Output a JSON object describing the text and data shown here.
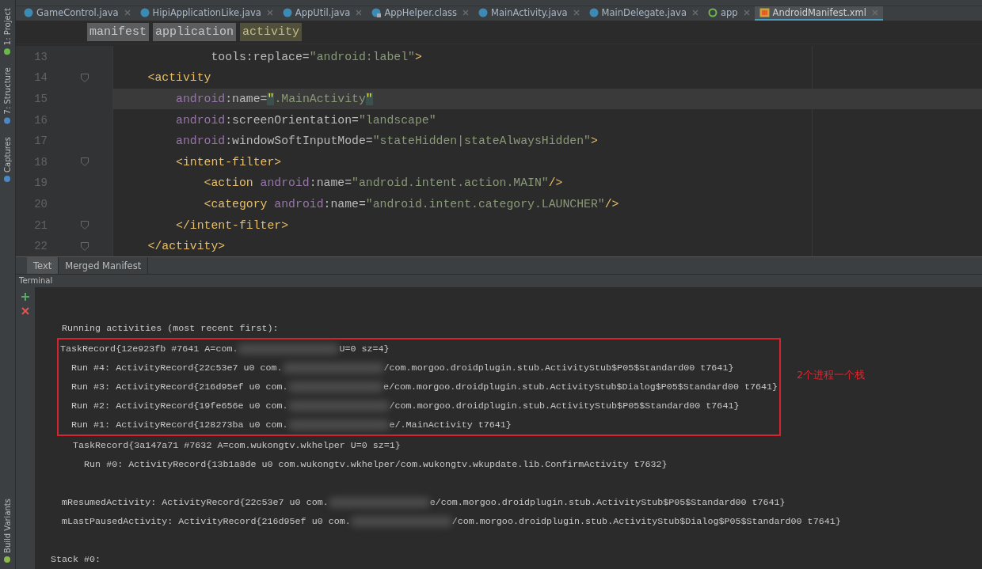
{
  "tool_strip": {
    "top": [
      "1: Project",
      "7: Structure",
      "Captures"
    ],
    "bottom": [
      "Build Variants"
    ]
  },
  "tabs": [
    {
      "label": "GameControl.java",
      "kind": "class",
      "selected": false
    },
    {
      "label": "HipiApplicationLike.java",
      "kind": "class",
      "selected": false
    },
    {
      "label": "AppUtil.java",
      "kind": "class",
      "selected": false
    },
    {
      "label": "AppHelper.class",
      "kind": "lockclass",
      "selected": false
    },
    {
      "label": "MainActivity.java",
      "kind": "class",
      "selected": false
    },
    {
      "label": "MainDelegate.java",
      "kind": "class",
      "selected": false
    },
    {
      "label": "app",
      "kind": "module",
      "selected": false
    },
    {
      "label": "AndroidManifest.xml",
      "kind": "xml",
      "selected": true
    }
  ],
  "breadcrumbs": [
    {
      "label": "manifest",
      "selected": false
    },
    {
      "label": "application",
      "selected": false
    },
    {
      "label": "activity",
      "selected": true
    }
  ],
  "editor": {
    "lines": [
      {
        "number": "13",
        "fold": false,
        "current": false,
        "tokens": [
          {
            "kind": "attr",
            "t": "             tools:replace="
          },
          {
            "kind": "value",
            "t": "\"android:label\""
          },
          {
            "kind": "tag",
            "t": ">"
          }
        ]
      },
      {
        "number": "14",
        "fold": true,
        "current": false,
        "tokens": [
          {
            "kind": "tag",
            "t": "    <activity"
          }
        ]
      },
      {
        "number": "15",
        "fold": false,
        "current": true,
        "tokens": [
          {
            "kind": "ns",
            "t": "        android"
          },
          {
            "kind": "attr",
            "t": ":name="
          },
          {
            "kind": "match",
            "t": "\""
          },
          {
            "kind": "value",
            "t": ".MainActivity"
          },
          {
            "kind": "match",
            "t": "\""
          }
        ]
      },
      {
        "number": "16",
        "fold": false,
        "current": false,
        "tokens": [
          {
            "kind": "ns",
            "t": "        android"
          },
          {
            "kind": "attr",
            "t": ":screenOrientation="
          },
          {
            "kind": "value",
            "t": "\"landscape\""
          }
        ]
      },
      {
        "number": "17",
        "fold": false,
        "current": false,
        "tokens": [
          {
            "kind": "ns",
            "t": "        android"
          },
          {
            "kind": "attr",
            "t": ":windowSoftInputMode="
          },
          {
            "kind": "value",
            "t": "\"stateHidden|stateAlwaysHidden\""
          },
          {
            "kind": "tag",
            "t": ">"
          }
        ]
      },
      {
        "number": "18",
        "fold": true,
        "current": false,
        "tokens": [
          {
            "kind": "tag",
            "t": "        <intent-filter>"
          }
        ]
      },
      {
        "number": "19",
        "fold": false,
        "current": false,
        "tokens": [
          {
            "kind": "tag",
            "t": "            <action "
          },
          {
            "kind": "ns",
            "t": "android"
          },
          {
            "kind": "attr",
            "t": ":name="
          },
          {
            "kind": "value",
            "t": "\"android.intent.action.MAIN\""
          },
          {
            "kind": "tag",
            "t": "/>"
          }
        ]
      },
      {
        "number": "20",
        "fold": false,
        "current": false,
        "tokens": [
          {
            "kind": "tag",
            "t": "            <category "
          },
          {
            "kind": "ns",
            "t": "android"
          },
          {
            "kind": "attr",
            "t": ":name="
          },
          {
            "kind": "value",
            "t": "\"android.intent.category.LAUNCHER\""
          },
          {
            "kind": "tag",
            "t": "/>"
          }
        ]
      },
      {
        "number": "21",
        "fold": true,
        "current": false,
        "tokens": [
          {
            "kind": "tag",
            "t": "        </intent-filter>"
          }
        ]
      },
      {
        "number": "22",
        "fold": true,
        "current": false,
        "tokens": [
          {
            "kind": "tag",
            "t": "    </activity>"
          }
        ]
      }
    ]
  },
  "view_tabs": [
    {
      "label": "Text",
      "selected": true
    },
    {
      "label": "Merged Manifest",
      "selected": false
    }
  ],
  "terminal": {
    "title": "Terminal",
    "annotation": "2个进程一个栈",
    "lines": [
      {
        "kind": "blank"
      },
      {
        "kind": "text",
        "boxed": false,
        "parts": [
          "  Running activities (most recent first):"
        ]
      },
      {
        "kind": "text",
        "boxed": true,
        "parts": [
          "TaskRecord{12e923fb #7641 A=com.",
          "U=0 sz=4}"
        ]
      },
      {
        "kind": "text",
        "boxed": true,
        "parts": [
          "  Run #4: ActivityRecord{22c53e7 u0 com.",
          "/com.morgoo.droidplugin.stub.ActivityStub$P05$Standard00 t7641}"
        ]
      },
      {
        "kind": "text",
        "boxed": true,
        "parts": [
          "  Run #3: ActivityRecord{216d95ef u0 com.",
          "e/com.morgoo.droidplugin.stub.ActivityStub$Dialog$P05$Standard00 t7641}"
        ]
      },
      {
        "kind": "text",
        "boxed": true,
        "parts": [
          "  Run #2: ActivityRecord{19fe656e u0 com.",
          "/com.morgoo.droidplugin.stub.ActivityStub$P05$Standard00 t7641}"
        ]
      },
      {
        "kind": "text",
        "boxed": true,
        "parts": [
          "  Run #1: ActivityRecord{128273ba u0 com.",
          "e/.MainActivity t7641}"
        ]
      },
      {
        "kind": "text",
        "boxed": false,
        "parts": [
          "    TaskRecord{3a147a71 #7632 A=com.wukongtv.wkhelper U=0 sz=1}"
        ]
      },
      {
        "kind": "text",
        "boxed": false,
        "parts": [
          "      Run #0: ActivityRecord{13b1a8de u0 com.wukongtv.wkhelper/com.wukongtv.wkupdate.lib.ConfirmActivity t7632}"
        ]
      },
      {
        "kind": "blank"
      },
      {
        "kind": "text",
        "boxed": false,
        "parts": [
          "  mResumedActivity: ActivityRecord{22c53e7 u0 com.",
          "e/com.morgoo.droidplugin.stub.ActivityStub$P05$Standard00 t7641}"
        ]
      },
      {
        "kind": "text",
        "boxed": false,
        "parts": [
          "  mLastPausedActivity: ActivityRecord{216d95ef u0 com.",
          "/com.morgoo.droidplugin.stub.ActivityStub$Dialog$P05$Standard00 t7641}"
        ]
      },
      {
        "kind": "blank"
      },
      {
        "kind": "text",
        "boxed": false,
        "parts": [
          "Stack #0:"
        ]
      }
    ]
  }
}
